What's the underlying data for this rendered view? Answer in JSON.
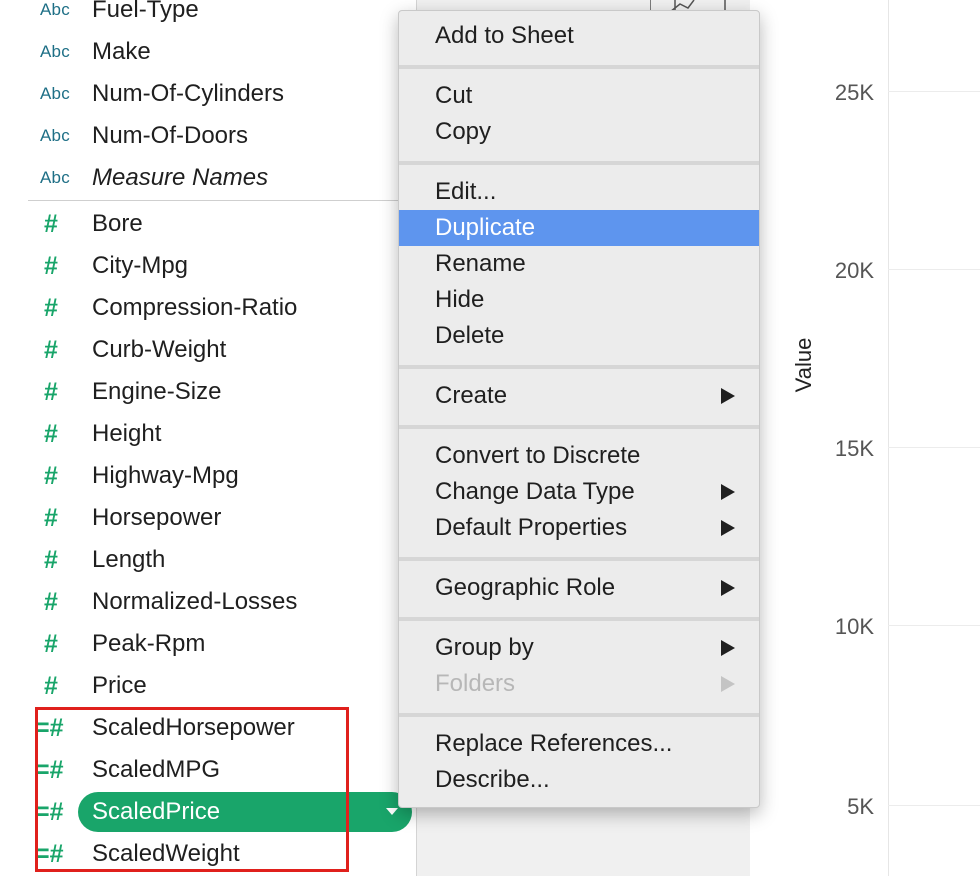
{
  "fields": [
    {
      "type": "Abc",
      "label": "Fuel-Type",
      "italic": false
    },
    {
      "type": "Abc",
      "label": "Make",
      "italic": false
    },
    {
      "type": "Abc",
      "label": "Num-Of-Cylinders",
      "italic": false
    },
    {
      "type": "Abc",
      "label": "Num-Of-Doors",
      "italic": false
    },
    {
      "type": "Abc",
      "label": "Measure Names",
      "italic": true
    },
    {
      "type": "#",
      "label": "Bore"
    },
    {
      "type": "#",
      "label": "City-Mpg"
    },
    {
      "type": "#",
      "label": "Compression-Ratio"
    },
    {
      "type": "#",
      "label": "Curb-Weight"
    },
    {
      "type": "#",
      "label": "Engine-Size"
    },
    {
      "type": "#",
      "label": "Height"
    },
    {
      "type": "#",
      "label": "Highway-Mpg"
    },
    {
      "type": "#",
      "label": "Horsepower"
    },
    {
      "type": "#",
      "label": "Length"
    },
    {
      "type": "#",
      "label": "Normalized-Losses"
    },
    {
      "type": "#",
      "label": "Peak-Rpm"
    },
    {
      "type": "#",
      "label": "Price"
    },
    {
      "type": "=#",
      "label": "ScaledHorsepower"
    },
    {
      "type": "=#",
      "label": "ScaledMPG"
    },
    {
      "type": "=#",
      "label": "ScaledPrice",
      "selected": true
    },
    {
      "type": "=#",
      "label": "ScaledWeight"
    }
  ],
  "menu": {
    "add_to_sheet": "Add to Sheet",
    "cut": "Cut",
    "copy": "Copy",
    "edit": "Edit...",
    "duplicate": "Duplicate",
    "rename": "Rename",
    "hide": "Hide",
    "delete": "Delete",
    "create": "Create",
    "convert_to_discrete": "Convert to Discrete",
    "change_data_type": "Change Data Type",
    "default_properties": "Default Properties",
    "geographic_role": "Geographic Role",
    "group_by": "Group by",
    "folders": "Folders",
    "replace_references": "Replace References...",
    "describe": "Describe..."
  },
  "chart": {
    "y_title": "Value",
    "ticks": [
      "25K",
      "20K",
      "15K",
      "10K",
      "5K"
    ]
  },
  "colors": {
    "measure_green": "#19a56a",
    "dimension_teal": "#1e6f86",
    "menu_highlight": "#5e95ee",
    "annotation_red": "#e0201c"
  }
}
